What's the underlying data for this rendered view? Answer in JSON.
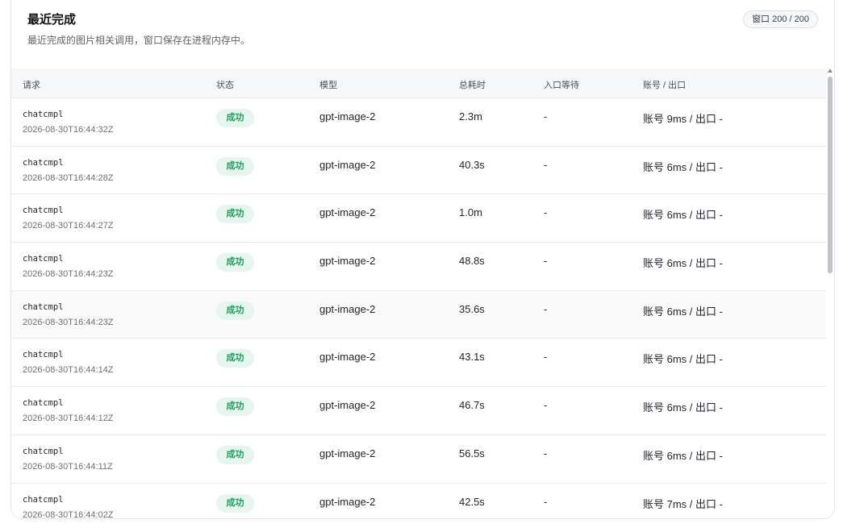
{
  "header": {
    "title": "最近完成",
    "subtitle": "最近完成的图片相关调用，窗口保存在进程内存中。",
    "window_badge": "窗口 200 / 200"
  },
  "columns": [
    "请求",
    "状态",
    "模型",
    "总耗时",
    "入口等待",
    "账号 / 出口"
  ],
  "rows": [
    {
      "request": "chatcmpl",
      "time": "2026-08-30T16:44:32Z",
      "status": "成功",
      "model": "gpt-image-2",
      "duration": "2.3m",
      "wait": "-",
      "account": "账号 9ms / 出口 -"
    },
    {
      "request": "chatcmpl",
      "time": "2026-08-30T16:44:28Z",
      "status": "成功",
      "model": "gpt-image-2",
      "duration": "40.3s",
      "wait": "-",
      "account": "账号 6ms / 出口 -"
    },
    {
      "request": "chatcmpl",
      "time": "2026-08-30T16:44:27Z",
      "status": "成功",
      "model": "gpt-image-2",
      "duration": "1.0m",
      "wait": "-",
      "account": "账号 6ms / 出口 -"
    },
    {
      "request": "chatcmpl",
      "time": "2026-08-30T16:44:23Z",
      "status": "成功",
      "model": "gpt-image-2",
      "duration": "48.8s",
      "wait": "-",
      "account": "账号 6ms / 出口 -"
    },
    {
      "request": "chatcmpl",
      "time": "2026-08-30T16:44:23Z",
      "status": "成功",
      "model": "gpt-image-2",
      "duration": "35.6s",
      "wait": "-",
      "account": "账号 6ms / 出口 -"
    },
    {
      "request": "chatcmpl",
      "time": "2026-08-30T16:44:14Z",
      "status": "成功",
      "model": "gpt-image-2",
      "duration": "43.1s",
      "wait": "-",
      "account": "账号 6ms / 出口 -"
    },
    {
      "request": "chatcmpl",
      "time": "2026-08-30T16:44:12Z",
      "status": "成功",
      "model": "gpt-image-2",
      "duration": "46.7s",
      "wait": "-",
      "account": "账号 6ms / 出口 -"
    },
    {
      "request": "chatcmpl",
      "time": "2026-08-30T16:44:11Z",
      "status": "成功",
      "model": "gpt-image-2",
      "duration": "56.5s",
      "wait": "-",
      "account": "账号 6ms / 出口 -"
    },
    {
      "request": "chatcmpl",
      "time": "2026-08-30T16:44:02Z",
      "status": "成功",
      "model": "gpt-image-2",
      "duration": "42.5s",
      "wait": "-",
      "account": "账号 7ms / 出口 -"
    }
  ],
  "colors": {
    "success_bg": "#e6f6ee",
    "success_text": "#1f9d5a"
  }
}
